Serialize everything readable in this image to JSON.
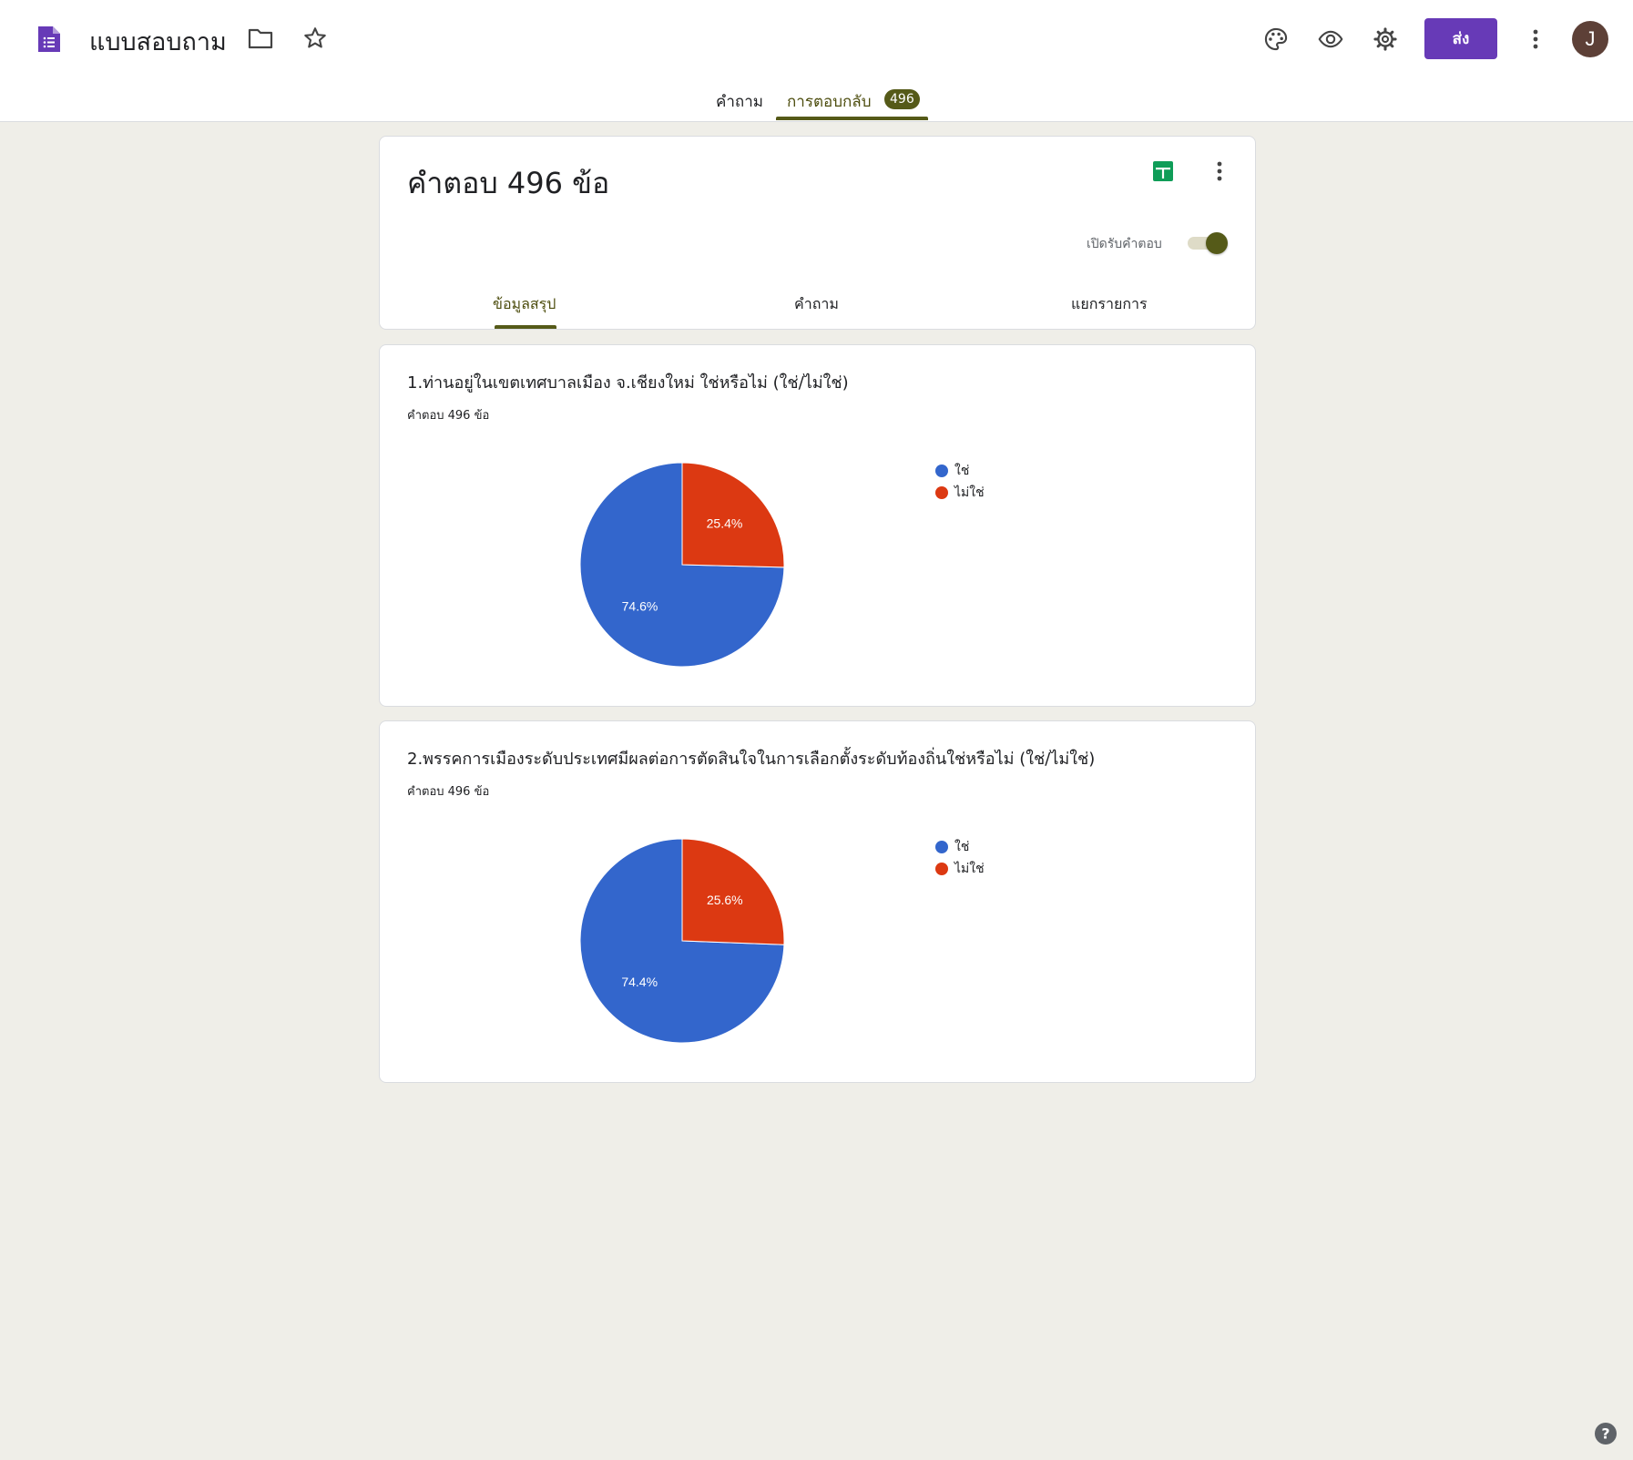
{
  "header": {
    "doc_title": "แบบสอบถาม",
    "send_label": "ส่ง",
    "avatar_letter": "J",
    "tabs": [
      {
        "label": "คำถาม"
      },
      {
        "label": "การตอบกลับ",
        "badge": "496"
      }
    ]
  },
  "summary": {
    "title": "คำตอบ 496 ข้อ",
    "accepting_label": "เปิดรับคำตอบ",
    "accepting": true,
    "tabs": [
      "ข้อมูลสรุป",
      "คำถาม",
      "แยกรายการ"
    ]
  },
  "questions": [
    {
      "title": "1.ท่านอยู่ในเขตเทศบาลเมือง จ.เชียงใหม่ ใช่หรือไม่ (ใช่/ไม่ใช่)",
      "response_count": "คำตอบ 496 ข้อ",
      "labels": [
        "74.6%",
        "25.4%"
      ]
    },
    {
      "title": "2.พรรคการเมืองระดับประเทศมีผลต่อการตัดสินใจในการเลือกตั้งระดับท้องถิ่นใช่หรือไม่ (ใช่/ไม่ใช่)",
      "response_count": "คำตอบ 496 ข้อ",
      "labels": [
        "74.4%",
        "25.6%"
      ]
    }
  ],
  "chart_data": [
    {
      "type": "pie",
      "categories": [
        "ใช่",
        "ไม่ใช่"
      ],
      "values": [
        74.6,
        25.4
      ],
      "colors": [
        "#3366cc",
        "#dc3912"
      ],
      "legend": "right"
    },
    {
      "type": "pie",
      "categories": [
        "ใช่",
        "ไม่ใช่"
      ],
      "values": [
        74.4,
        25.6
      ],
      "colors": [
        "#3366cc",
        "#dc3912"
      ],
      "legend": "right"
    }
  ],
  "colors": {
    "brand": "#673ab7",
    "accent": "#555a18",
    "background": "#efeee8"
  },
  "icons": [
    "forms-icon",
    "folder-icon",
    "star-icon",
    "palette-icon",
    "eye-icon",
    "gear-icon",
    "more-vert-icon",
    "sheets-icon",
    "help-icon"
  ]
}
